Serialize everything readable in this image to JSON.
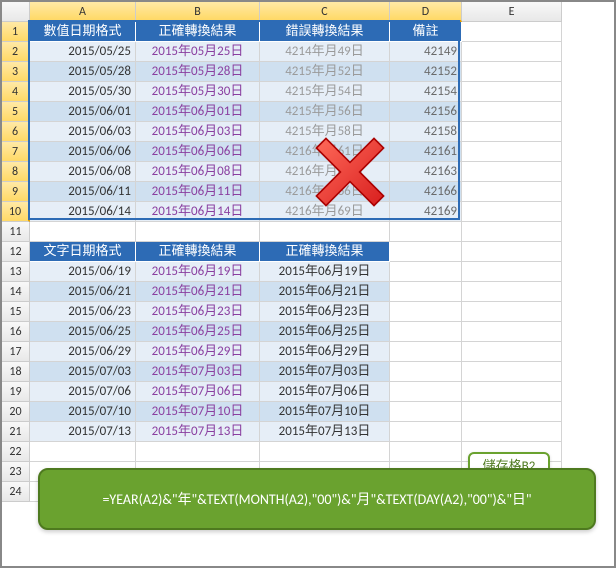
{
  "columns": [
    "A",
    "B",
    "C",
    "D",
    "E"
  ],
  "rows": [
    "1",
    "2",
    "3",
    "4",
    "5",
    "6",
    "7",
    "8",
    "9",
    "10",
    "11",
    "12",
    "13",
    "14",
    "15",
    "16",
    "17",
    "18",
    "19",
    "20",
    "21",
    "22",
    "23",
    "24"
  ],
  "table1": {
    "headers": [
      "數值日期格式",
      "正確轉換結果",
      "錯誤轉換結果",
      "備註"
    ],
    "rows": [
      {
        "a": "2015/05/25",
        "b": "2015年05月25日",
        "c": "4214年月49日",
        "d": "42149"
      },
      {
        "a": "2015/05/28",
        "b": "2015年05月28日",
        "c": "4215年月52日",
        "d": "42152"
      },
      {
        "a": "2015/05/30",
        "b": "2015年05月30日",
        "c": "4215年月54日",
        "d": "42154"
      },
      {
        "a": "2015/06/01",
        "b": "2015年06月01日",
        "c": "4215年月56日",
        "d": "42156"
      },
      {
        "a": "2015/06/03",
        "b": "2015年06月03日",
        "c": "4215年月58日",
        "d": "42158"
      },
      {
        "a": "2015/06/06",
        "b": "2015年06月06日",
        "c": "4216年月61日",
        "d": "42161"
      },
      {
        "a": "2015/06/08",
        "b": "2015年06月08日",
        "c": "4216年月63日",
        "d": "42163"
      },
      {
        "a": "2015/06/11",
        "b": "2015年06月11日",
        "c": "4216年月66日",
        "d": "42166"
      },
      {
        "a": "2015/06/14",
        "b": "2015年06月14日",
        "c": "4216年月69日",
        "d": "42169"
      }
    ]
  },
  "table2": {
    "headers": [
      "文字日期格式",
      "正確轉換結果",
      "正確轉換結果"
    ],
    "rows": [
      {
        "a": "2015/06/19",
        "b": "2015年06月19日",
        "c": "2015年06月19日"
      },
      {
        "a": "2015/06/21",
        "b": "2015年06月21日",
        "c": "2015年06月21日"
      },
      {
        "a": "2015/06/23",
        "b": "2015年06月23日",
        "c": "2015年06月23日"
      },
      {
        "a": "2015/06/25",
        "b": "2015年06月25日",
        "c": "2015年06月25日"
      },
      {
        "a": "2015/06/29",
        "b": "2015年06月29日",
        "c": "2015年06月29日"
      },
      {
        "a": "2015/07/03",
        "b": "2015年07月03日",
        "c": "2015年07月03日"
      },
      {
        "a": "2015/07/06",
        "b": "2015年07月06日",
        "c": "2015年07月06日"
      },
      {
        "a": "2015/07/10",
        "b": "2015年07月10日",
        "c": "2015年07月10日"
      },
      {
        "a": "2015/07/13",
        "b": "2015年07月13日",
        "c": "2015年07月13日"
      }
    ]
  },
  "cell_tag": "儲存格B2",
  "formula": "=YEAR(A2)&\"年\"&TEXT(MONTH(A2),\"00\")&\"月\"&TEXT(DAY(A2),\"00\")&\"日\""
}
